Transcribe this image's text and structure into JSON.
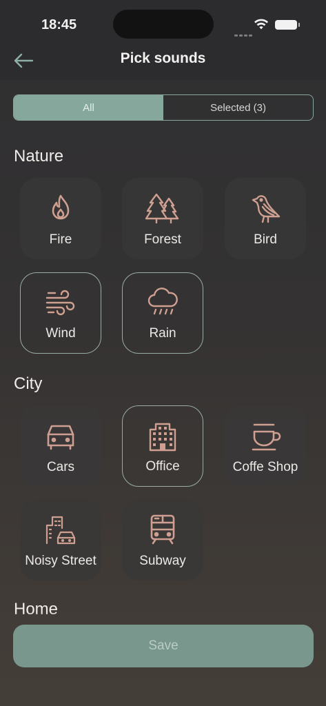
{
  "status_bar": {
    "time": "18:45"
  },
  "header": {
    "title": "Pick sounds",
    "back_icon": "arrow-left-icon"
  },
  "tabs": [
    {
      "label": "All",
      "active": true
    },
    {
      "label": "Selected (3)",
      "active": false
    }
  ],
  "sections": [
    {
      "title": "Nature",
      "items": [
        {
          "label": "Fire",
          "icon": "flame-icon",
          "selected": false
        },
        {
          "label": "Forest",
          "icon": "trees-icon",
          "selected": false
        },
        {
          "label": "Bird",
          "icon": "bird-icon",
          "selected": false
        },
        {
          "label": "Wind",
          "icon": "wind-icon",
          "selected": true
        },
        {
          "label": "Rain",
          "icon": "rain-cloud-icon",
          "selected": true
        }
      ]
    },
    {
      "title": "City",
      "items": [
        {
          "label": "Cars",
          "icon": "car-icon",
          "selected": false
        },
        {
          "label": "Office",
          "icon": "office-building-icon",
          "selected": true
        },
        {
          "label": "Coffe Shop",
          "icon": "coffee-cup-icon",
          "selected": false
        },
        {
          "label": "Noisy Street",
          "icon": "street-buildings-car-icon",
          "selected": false
        },
        {
          "label": "Subway",
          "icon": "train-icon",
          "selected": false
        }
      ]
    },
    {
      "title": "Home",
      "items": []
    }
  ],
  "save_button": {
    "label": "Save"
  },
  "colors": {
    "accent": "#85a79c",
    "icon": "#cfa091",
    "selected_border": "#9aaea6",
    "background": "#2f2f31"
  }
}
